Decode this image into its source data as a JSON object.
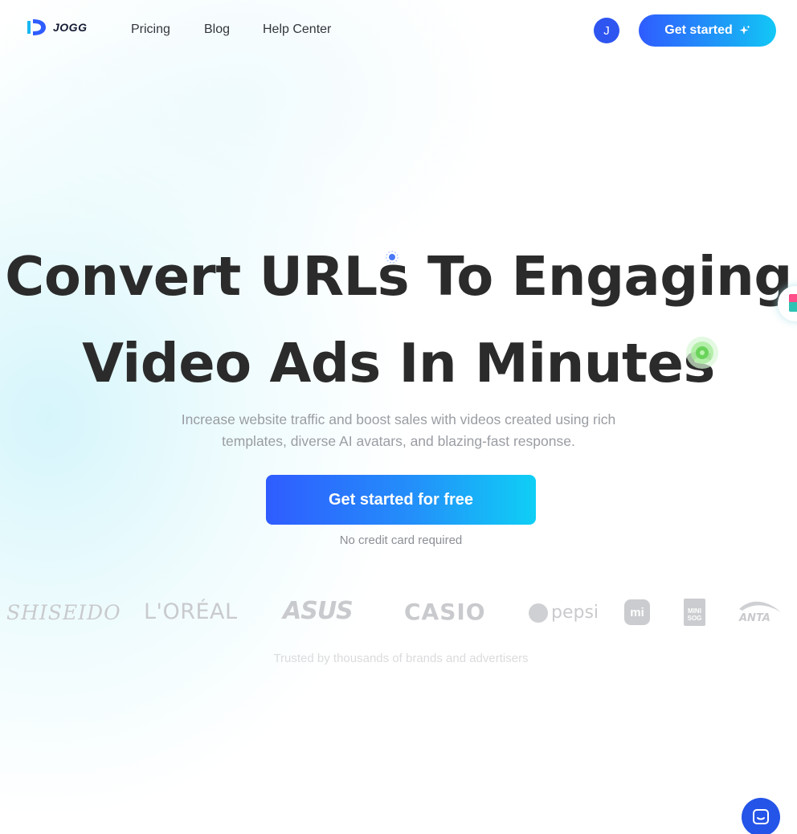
{
  "nav": {
    "logo_text": "JOGG",
    "links": [
      "Pricing",
      "Blog",
      "Help Center"
    ],
    "avatar_initial": "J",
    "cta_label": "Get started"
  },
  "hero": {
    "title_line1": "Convert URLs To Engaging",
    "title_line2": "Video Ads In Minutes",
    "subtitle_line1": "Increase website traffic and boost sales with videos created using rich",
    "subtitle_line2": "templates, diverse AI avatars, and blazing-fast response.",
    "cta_label": "Get started for free",
    "note": "No credit card required"
  },
  "brands": {
    "shiseido": "SHISEIDO",
    "loreal": "L'ORÉAL",
    "asus": "ASUS",
    "casio": "CASIO",
    "pepsi": "pepsi",
    "mi": "mi",
    "minisog_line1": "MINI",
    "minisog_line2": "SOG",
    "anta": "ANTA",
    "trusted_text": "Trusted by thousands of brands and advertisers"
  },
  "colors": {
    "accent_blue": "#2f5cff",
    "accent_cyan": "#12c8f6",
    "chat_blue": "#2454e8"
  },
  "icons": {
    "sparkle": "sparkle-icon",
    "chat": "chat-icon"
  }
}
